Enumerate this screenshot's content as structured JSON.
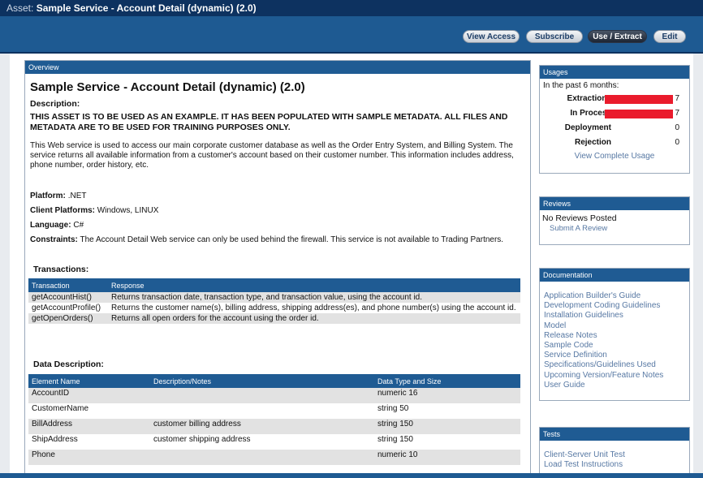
{
  "title": {
    "prefix": "Asset:",
    "name": "Sample Service - Account Detail (dynamic) (2.0)"
  },
  "toolbar": {
    "view_access": "View Access",
    "subscribe": "Subscribe",
    "use_extract": "Use / Extract",
    "edit": "Edit"
  },
  "overview": {
    "panel_title": "Overview",
    "heading": "Sample Service - Account Detail (dynamic) (2.0)",
    "description_label": "Description:",
    "warning": "THIS ASSET IS TO BE USED AS AN EXAMPLE. IT HAS BEEN POPULATED WITH SAMPLE METADATA. ALL FILES AND METADATA ARE TO BE USED FOR TRAINING PURPOSES ONLY.",
    "description": "This Web service is used to access our main corporate customer database as well as the Order Entry System, and Billing System. The service returns all available information from a customer's account based on their customer number. This information includes address, phone number, order history, etc.",
    "platform_label": "Platform:",
    "platform": ".NET",
    "client_platforms_label": "Client Platforms:",
    "client_platforms": "Windows, LINUX",
    "language_label": "Language:",
    "language": "C#",
    "constraints_label": "Constraints:",
    "constraints": "The Account Detail Web service can only be used behind the firewall. This service is not available to Trading Partners.",
    "transactions_label": "Transactions:",
    "transactions_headers": [
      "Transaction",
      "Response"
    ],
    "transactions": [
      [
        "getAccountHist()",
        "Returns transaction date, transaction type, and transaction value, using the account id."
      ],
      [
        "getAccountProfile()",
        "Returns the customer name(s), billing address, shipping address(es), and phone number(s) using the account id."
      ],
      [
        "getOpenOrders()",
        "Returns all open orders for the account using the order id."
      ]
    ],
    "data_description_label": "Data Description:",
    "data_headers": [
      "Element Name",
      "Description/Notes",
      "Data Type and Size"
    ],
    "data_rows": [
      [
        "AccountID",
        "",
        "numeric 16"
      ],
      [
        "CustomerName",
        "",
        "string 50"
      ],
      [
        "BillAddress",
        "customer billing address",
        "string 150"
      ],
      [
        "ShipAddress",
        "customer shipping address",
        "string 150"
      ],
      [
        "Phone",
        "",
        "numeric 10"
      ]
    ]
  },
  "usages": {
    "panel_title": "Usages",
    "period": "In the past 6 months:",
    "max": 7,
    "rows": [
      {
        "label": "Extractions",
        "value": "7"
      },
      {
        "label": "In Process",
        "value": "7"
      },
      {
        "label": "Deployment",
        "value": "0"
      },
      {
        "label": "Rejection",
        "value": "0"
      }
    ],
    "link": "View Complete Usage",
    "bar_color": "#ea1b2c"
  },
  "reviews": {
    "panel_title": "Reviews",
    "status": "No Reviews Posted",
    "link": "Submit A Review"
  },
  "documentation": {
    "panel_title": "Documentation",
    "items": [
      "Application Builder's Guide",
      "Development Coding Guidelines",
      "Installation Guidelines",
      "Model",
      "Release Notes",
      "Sample Code",
      "Service Definition",
      "Specifications/Guidelines Used",
      "Upcoming Version/Feature Notes",
      "User Guide"
    ]
  },
  "tests": {
    "panel_title": "Tests",
    "items": [
      "Client-Server Unit Test",
      "Load Test Instructions"
    ]
  }
}
